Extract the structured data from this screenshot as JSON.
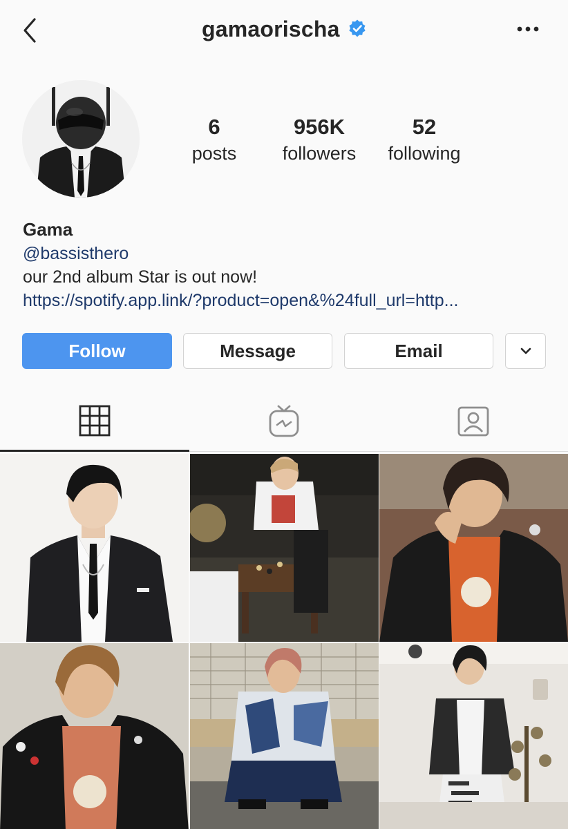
{
  "header": {
    "username": "gamaorischa",
    "verified": true,
    "back_icon": "chevron-left-icon",
    "more_icon": "more-horizontal-icon"
  },
  "stats": {
    "posts_count": "6",
    "posts_label": "posts",
    "followers_count": "956K",
    "followers_label": "followers",
    "following_count": "52",
    "following_label": "following"
  },
  "bio": {
    "name": "Gama",
    "handle": "@bassisthero",
    "text": "our 2nd album Star is out now!",
    "link": "https://spotify.app.link/?product=open&%24full_url=http..."
  },
  "actions": {
    "follow_label": "Follow",
    "message_label": "Message",
    "email_label": "Email",
    "more_icon": "chevron-down-icon"
  },
  "tabs": [
    {
      "name": "posts-grid",
      "icon": "grid-icon",
      "active": true
    },
    {
      "name": "igtv",
      "icon": "igtv-icon",
      "active": false
    },
    {
      "name": "tagged",
      "icon": "tagged-user-icon",
      "active": false
    }
  ],
  "colors": {
    "accent": "#4d95ef",
    "verified": "#3897f0",
    "link": "#1f3a6b",
    "text": "#262626",
    "background": "#fafafa"
  },
  "posts": [
    {
      "id": "post-1"
    },
    {
      "id": "post-2"
    },
    {
      "id": "post-3"
    },
    {
      "id": "post-4"
    },
    {
      "id": "post-5"
    },
    {
      "id": "post-6"
    }
  ]
}
